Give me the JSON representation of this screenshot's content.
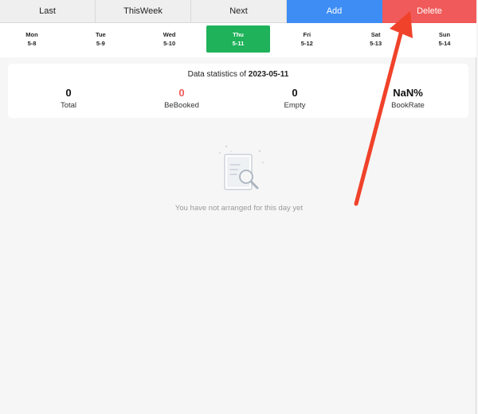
{
  "toolbar": {
    "last_label": "Last",
    "thisweek_label": "ThisWeek",
    "next_label": "Next",
    "add_label": "Add",
    "delete_label": "Delete",
    "add_color": "#3d8df5",
    "delete_color": "#f05a5a"
  },
  "days": [
    {
      "name": "Mon",
      "date": "5-8",
      "active": false
    },
    {
      "name": "Tue",
      "date": "5-9",
      "active": false
    },
    {
      "name": "Wed",
      "date": "5-10",
      "active": false
    },
    {
      "name": "Thu",
      "date": "5-11",
      "active": true
    },
    {
      "name": "Fri",
      "date": "5-12",
      "active": false
    },
    {
      "name": "Sat",
      "date": "5-13",
      "active": false
    },
    {
      "name": "Sun",
      "date": "5-14",
      "active": false
    }
  ],
  "stats": {
    "title_prefix": "Data statistics of",
    "date": "2023-05-11",
    "total_value": "0",
    "total_label": "Total",
    "booked_value": "0",
    "booked_label": "BeBooked",
    "empty_value": "0",
    "empty_label": "Empty",
    "rate_value": "NaN%",
    "rate_label": "BookRate"
  },
  "empty_state": {
    "icon": "document-search-icon",
    "message": "You have not arranged for this day yet"
  },
  "annotation": {
    "color": "#f0422a"
  }
}
